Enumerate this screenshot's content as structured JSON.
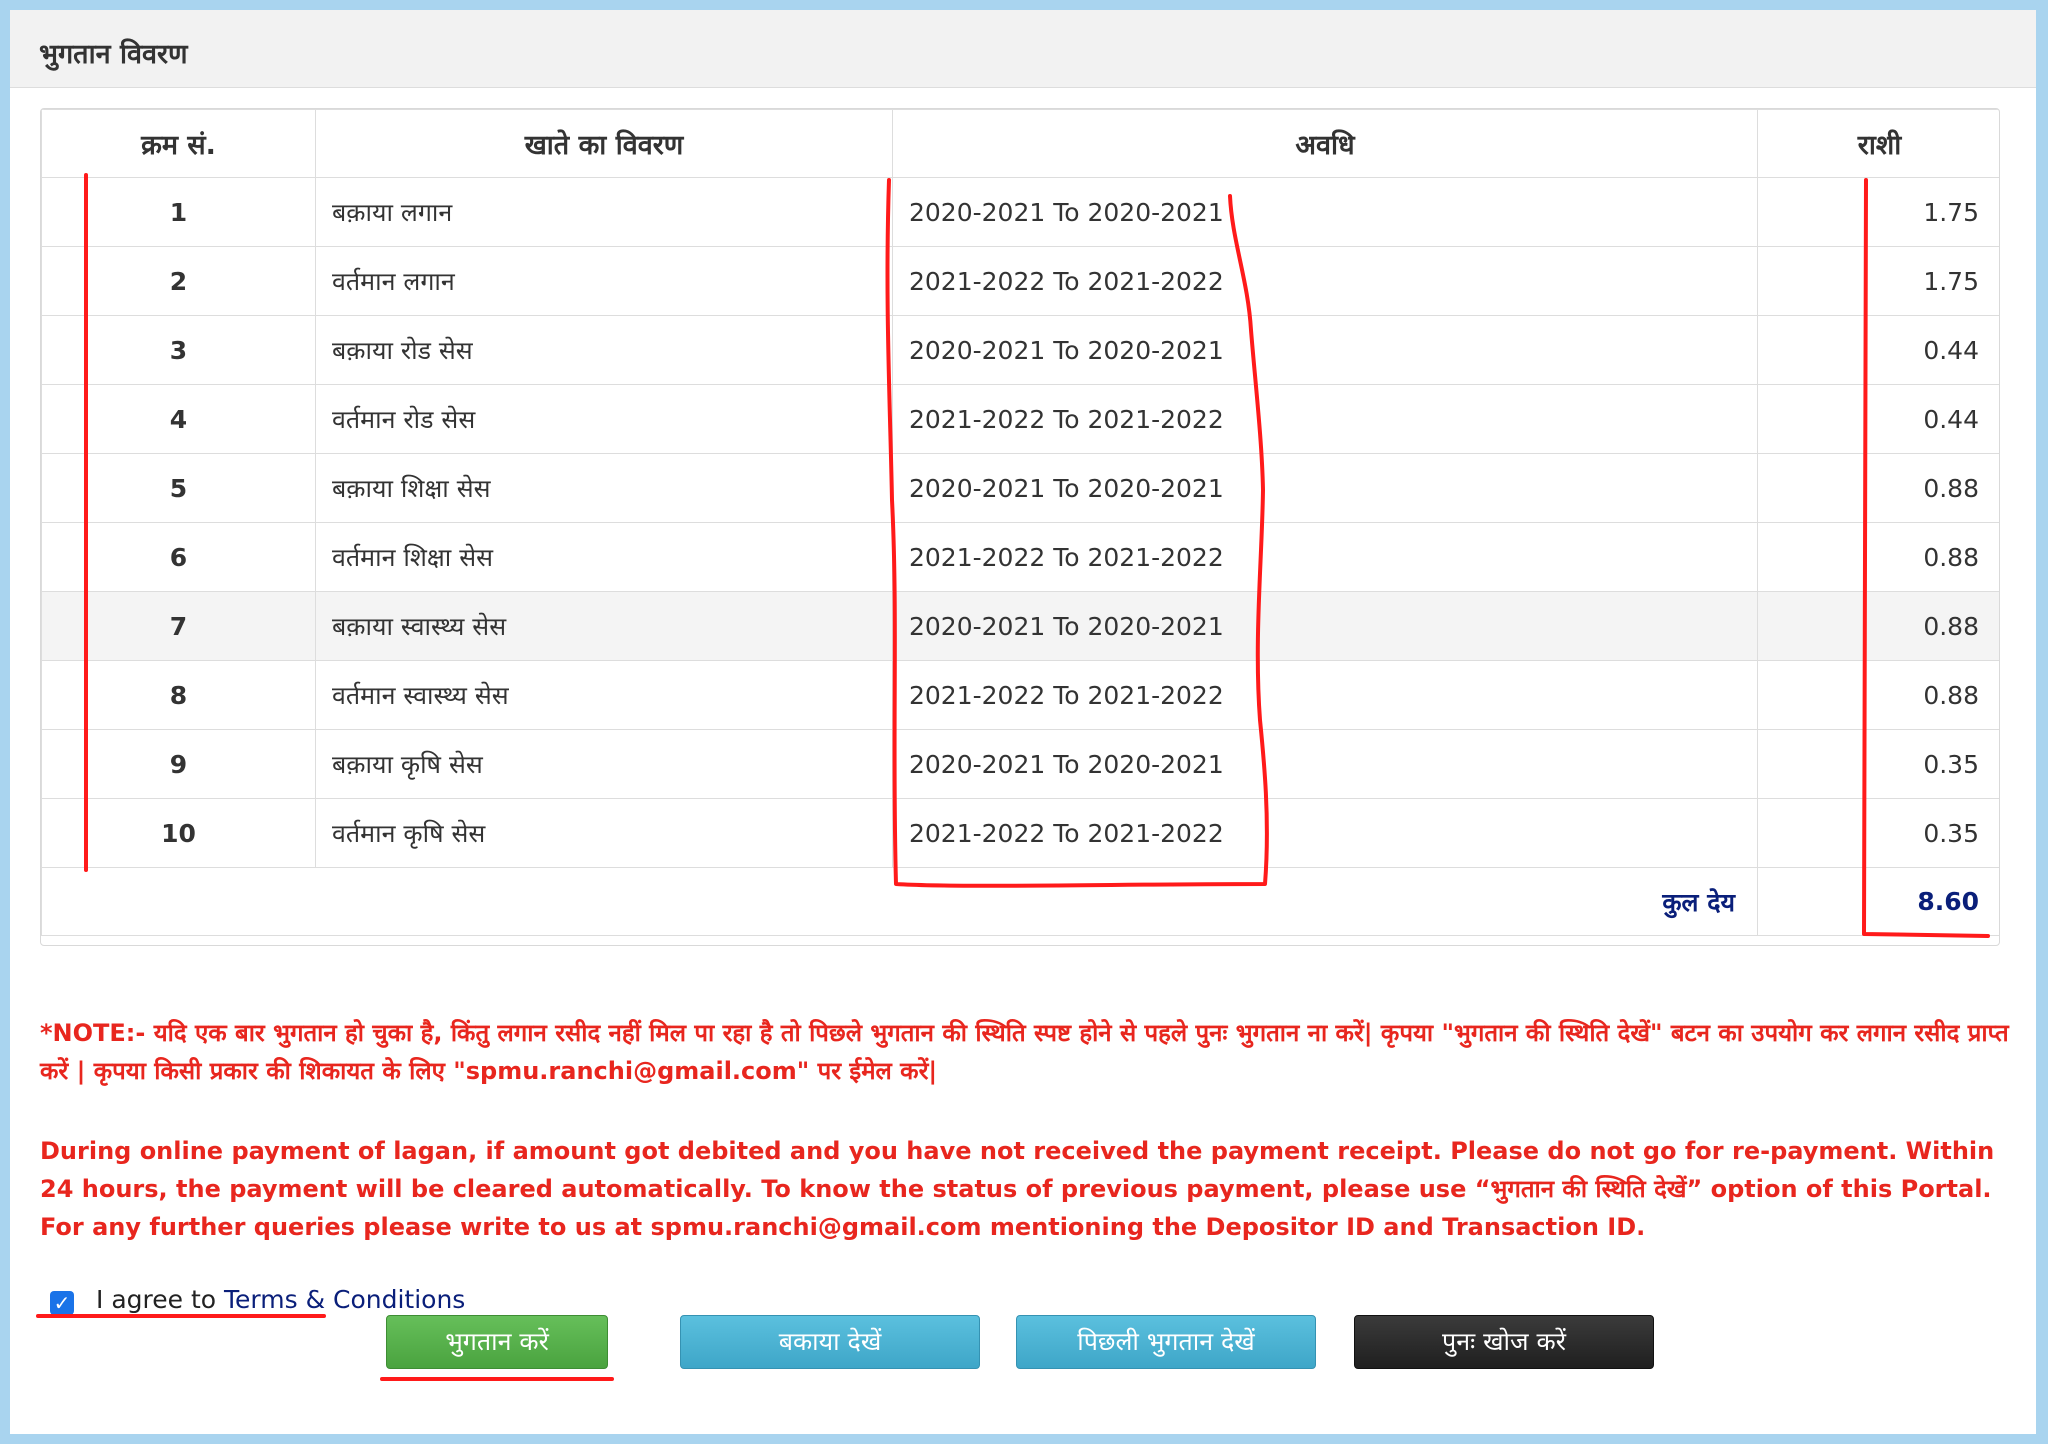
{
  "panel": {
    "title": "भुगतान विवरण"
  },
  "table": {
    "headers": [
      "क्रम सं.",
      "खाते का विवरण",
      "अवधि",
      "राशी"
    ],
    "rows": [
      {
        "sn": "1",
        "desc": "बक़ाया लगान",
        "period": "2020-2021 To 2020-2021",
        "amount": "1.75"
      },
      {
        "sn": "2",
        "desc": "वर्तमान लगान",
        "period": "2021-2022 To 2021-2022",
        "amount": "1.75"
      },
      {
        "sn": "3",
        "desc": "बक़ाया रोड सेस",
        "period": "2020-2021 To 2020-2021",
        "amount": "0.44"
      },
      {
        "sn": "4",
        "desc": "वर्तमान रोड सेस",
        "period": "2021-2022 To 2021-2022",
        "amount": "0.44"
      },
      {
        "sn": "5",
        "desc": "बक़ाया शिक्षा सेस",
        "period": "2020-2021 To 2020-2021",
        "amount": "0.88"
      },
      {
        "sn": "6",
        "desc": "वर्तमान शिक्षा सेस",
        "period": "2021-2022 To 2021-2022",
        "amount": "0.88"
      },
      {
        "sn": "7",
        "desc": "बक़ाया स्वास्थ्य सेस",
        "period": "2020-2021 To 2020-2021",
        "amount": "0.88"
      },
      {
        "sn": "8",
        "desc": "वर्तमान स्वास्थ्य सेस",
        "period": "2021-2022 To 2021-2022",
        "amount": "0.88"
      },
      {
        "sn": "9",
        "desc": "बक़ाया कृषि सेस",
        "period": "2020-2021 To 2020-2021",
        "amount": "0.35"
      },
      {
        "sn": "10",
        "desc": "वर्तमान कृषि सेस",
        "period": "2021-2022 To 2021-2022",
        "amount": "0.35"
      }
    ],
    "total_label": "कुल देय",
    "total_value": "8.60"
  },
  "notes": {
    "hindi": "*NOTE:- यदि एक बार भुगतान हो चुका है, किंतु लगान रसीद नहीं मिल पा रहा है तो पिछले भुगतान की स्थिति स्पष्ट होने से पहले पुनः भुगतान ना करें| कृपया \"भुगतान की स्थिति देखें\" बटन का उपयोग कर लगान रसीद प्राप्त करें | कृपया किसी प्रकार की शिकायत के लिए \"spmu.ranchi@gmail.com\" पर ईमेल करें|",
    "english": "During online payment of lagan, if amount got debited and you have not received the payment receipt. Please do not go for re-payment. Within 24 hours, the payment will be cleared automatically. To know the status of previous payment, please use “भुगतान की स्थिति देखें” option of this Portal. For any further queries please write to us at spmu.ranchi@gmail.com mentioning the Depositor ID and Transaction ID."
  },
  "agree": {
    "prefix": "I agree to ",
    "link": "Terms & Conditions",
    "checked": true
  },
  "buttons": {
    "pay": "भुगतान करें",
    "view_due": "बकाया देखें",
    "prev_payment": "पिछली भुगतान देखें",
    "search_again": "पुनः खोज करें"
  },
  "colors": {
    "note_red": "#e8261e",
    "total_blue": "#0a1f7a",
    "annotation_red": "#ff1a1a",
    "pay_green": "#4aa33f",
    "info_blue": "#3ea6c8",
    "dark": "#1f1f1f"
  }
}
